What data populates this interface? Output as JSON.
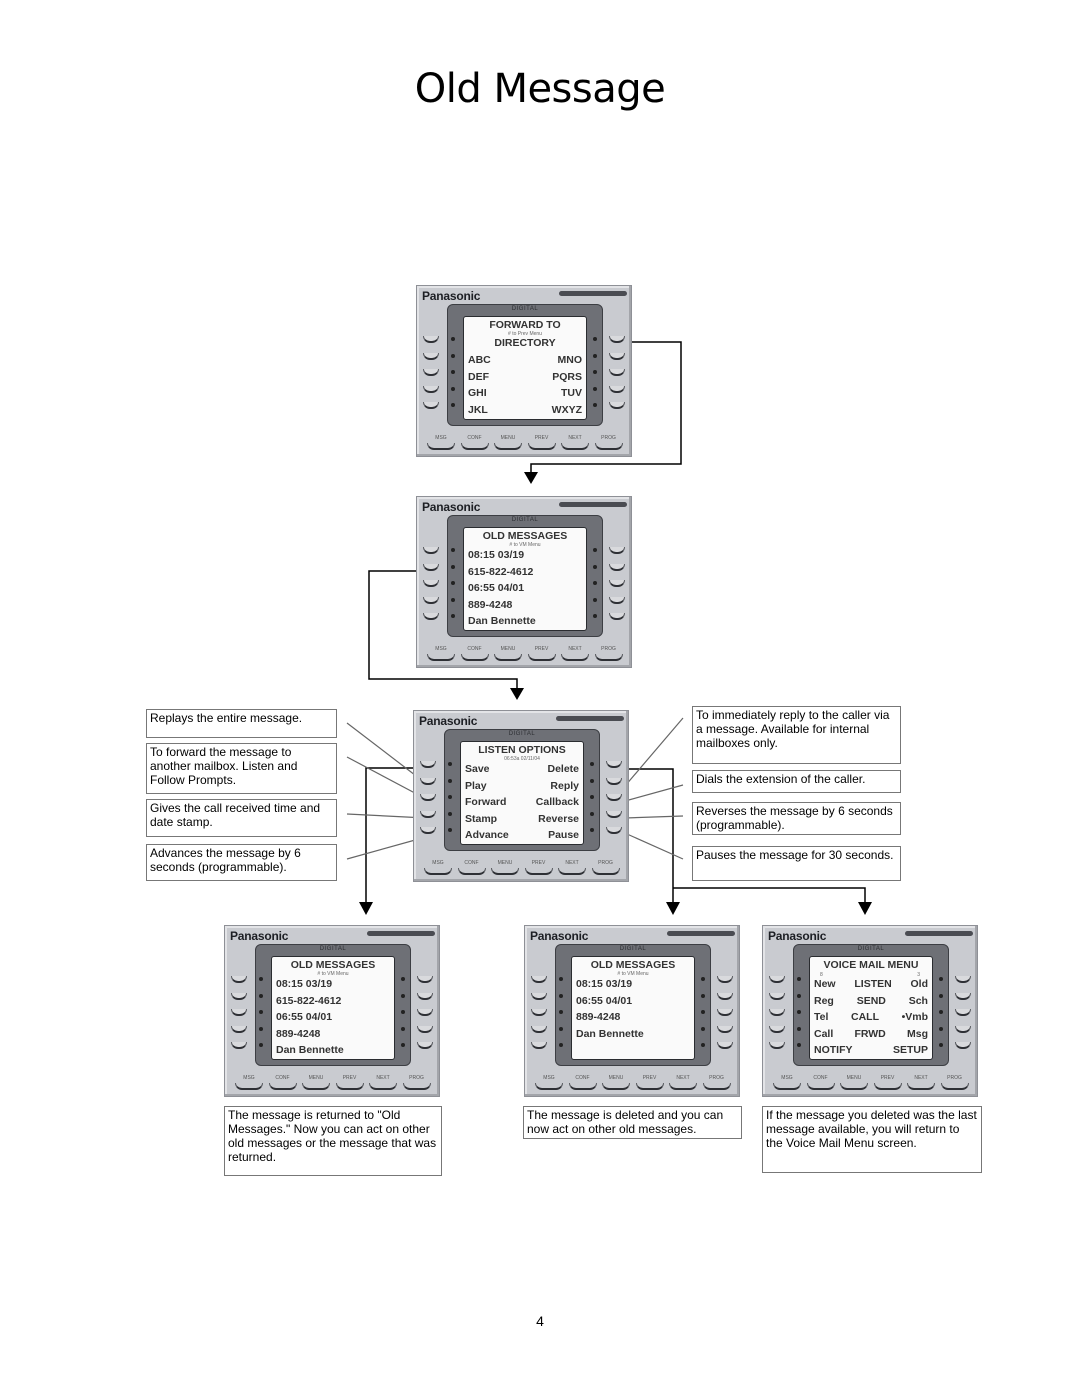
{
  "page": {
    "title": "Old Message",
    "page_number": "4"
  },
  "phone_common": {
    "brand": "Panasonic",
    "display_header": "DIGITAL",
    "soft_keys": [
      "MSG",
      "CONF",
      "MENU",
      "PREV",
      "NEXT",
      "PROG"
    ]
  },
  "phones": {
    "forward_to": {
      "title": "FORWARD TO",
      "subtitle": "# to Prev Menu",
      "heading": "DIRECTORY",
      "rows": [
        {
          "left": "ABC",
          "right": "MNO"
        },
        {
          "left": "DEF",
          "right": "PQRS"
        },
        {
          "left": "GHI",
          "right": "TUV"
        },
        {
          "left": "JKL",
          "right": "WXYZ"
        }
      ]
    },
    "old_messages_top": {
      "title": "OLD MESSAGES",
      "subtitle": "# to VM Menu",
      "rows": [
        "08:15 03/19",
        "615-822-4612",
        "06:55 04/01",
        "889-4248",
        "Dan Bennette"
      ]
    },
    "listen_options": {
      "title": "LISTEN OPTIONS",
      "subtitle": "06:53a 02/11/04",
      "rows": [
        {
          "left": "Save",
          "right": "Delete"
        },
        {
          "left": "Play",
          "right": "Reply"
        },
        {
          "left": "Forward",
          "right": "Callback"
        },
        {
          "left": "Stamp",
          "right": "Reverse"
        },
        {
          "left": "Advance",
          "right": "Pause"
        }
      ]
    },
    "old_messages_returned": {
      "title": "OLD MESSAGES",
      "subtitle": "# to VM Menu",
      "rows": [
        "08:15 03/19",
        "615-822-4612",
        "06:55 04/01",
        "889-4248",
        "Dan Bennette"
      ]
    },
    "old_messages_deleted": {
      "title": "OLD MESSAGES",
      "subtitle": "# to VM Menu",
      "rows": [
        "08:15 03/19",
        "06:55 04/01",
        "889-4248",
        "Dan Bennette"
      ]
    },
    "voice_mail_menu": {
      "title": "VOICE MAIL MENU",
      "counts": {
        "new": "8",
        "old": "3"
      },
      "rows": [
        {
          "left": "New",
          "center": "LISTEN",
          "right": "Old"
        },
        {
          "left": "Reg",
          "center": "SEND",
          "right": "Sch"
        },
        {
          "left": "Tel",
          "center": "CALL",
          "right": "•Vmb"
        },
        {
          "left": "Call",
          "center": "FRWD",
          "right": "Msg"
        },
        {
          "left": "NOTIFY",
          "center": "",
          "right": "SETUP"
        }
      ]
    }
  },
  "captions": {
    "play": "Replays the entire message.",
    "forward": "To forward the message to another mailbox.  Listen and Follow Prompts.",
    "stamp": "Gives the call received time and date stamp.",
    "advance": "Advances the message by 6 seconds (programmable).",
    "reply": "To immediately reply to the caller via a message.  Available for internal mailboxes only.",
    "callback": "Dials the extension of the caller.",
    "reverse": "Reverses the message by 6 seconds (programmable).",
    "pause": "Pauses the message for 30 seconds.",
    "returned": "The message is returned to \"Old Messages.\"  Now you can act on other old messages or the message that was returned.",
    "deleted": "The message is deleted and you can now act on other old messages.",
    "last_deleted": "If the message you deleted was the last message available, you will return to the Voice Mail Menu screen."
  }
}
